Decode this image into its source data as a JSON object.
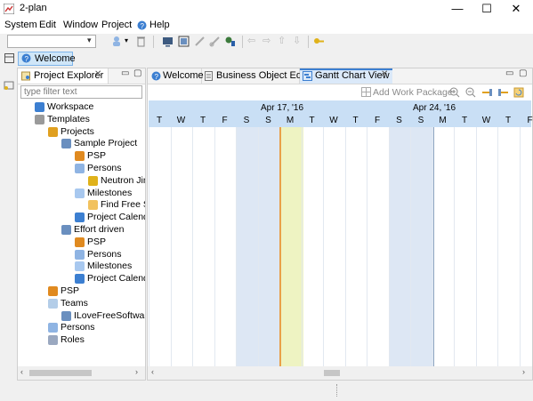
{
  "window": {
    "title": "2-plan",
    "min": "—",
    "max": "☐",
    "close": "✕"
  },
  "menu": [
    "System",
    "Edit",
    "Window",
    "Project",
    "Help"
  ],
  "perspective": {
    "welcome": "Welcome"
  },
  "explorer": {
    "tab_label": "Project Explorer",
    "filter_placeholder": "type filter text",
    "tree": [
      {
        "label": "Workspace",
        "level": 0,
        "icon": "workspace-icon"
      },
      {
        "label": "Templates",
        "level": 0,
        "icon": "templates-icon"
      },
      {
        "label": "Projects",
        "level": 1,
        "icon": "projects-icon"
      },
      {
        "label": "Sample Project",
        "level": 2,
        "icon": "project-icon"
      },
      {
        "label": "PSP",
        "level": 3,
        "icon": "psp-icon"
      },
      {
        "label": "Persons",
        "level": 3,
        "icon": "persons-icon"
      },
      {
        "label": "Neutron Jim",
        "level": 4,
        "icon": "person-icon"
      },
      {
        "label": "Milestones",
        "level": 3,
        "icon": "milestones-icon"
      },
      {
        "label": "Find Free Sc",
        "level": 4,
        "icon": "milestone-icon"
      },
      {
        "label": "Project Calenda",
        "level": 3,
        "icon": "calendar-icon"
      },
      {
        "label": "Effort driven",
        "level": 2,
        "icon": "project-icon"
      },
      {
        "label": "PSP",
        "level": 3,
        "icon": "psp-icon"
      },
      {
        "label": "Persons",
        "level": 3,
        "icon": "persons-icon"
      },
      {
        "label": "Milestones",
        "level": 3,
        "icon": "milestones-icon"
      },
      {
        "label": "Project Calenda",
        "level": 3,
        "icon": "calendar-icon"
      },
      {
        "label": "PSP",
        "level": 1,
        "icon": "psp-icon"
      },
      {
        "label": "Teams",
        "level": 1,
        "icon": "teams-icon"
      },
      {
        "label": "ILoveFreeSoftware.",
        "level": 2,
        "icon": "team-icon"
      },
      {
        "label": "Persons",
        "level": 1,
        "icon": "persons-icon"
      },
      {
        "label": "Roles",
        "level": 1,
        "icon": "roles-icon"
      }
    ]
  },
  "editor_tabs": [
    "Welcome",
    "Business Object Editor",
    "Gantt Chart View"
  ],
  "gantt": {
    "add_work_package": "Add Work Package",
    "weeks": [
      "Apr 17, '16",
      "Apr 24, '16"
    ],
    "days": [
      "T",
      "W",
      "T",
      "F",
      "S",
      "S",
      "M",
      "T",
      "W",
      "T",
      "F",
      "S",
      "S",
      "M",
      "T",
      "W",
      "T",
      "F"
    ],
    "today_index": 6
  },
  "colors": {
    "accent": "#3c7fd1",
    "today": "#eef3c2",
    "today_line": "#e9a04a",
    "header": "#c9dff5"
  }
}
